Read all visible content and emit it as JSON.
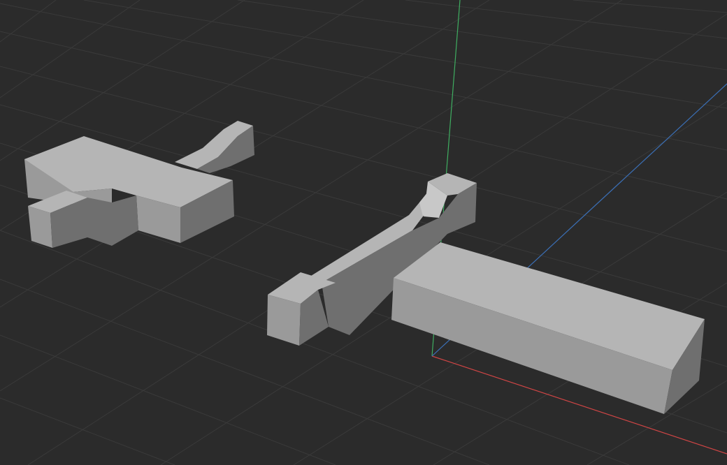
{
  "viewport": {
    "background_color": "#2b2b2b",
    "grid_color": "#3a3a3a",
    "axis_colors": {
      "x": "#d04545",
      "y": "#3fae61",
      "z": "#3b6fb5"
    }
  },
  "objects": [
    {
      "name": "cross-shaped-block",
      "face_colors": [
        "#b5b5b5",
        "#9a9a9a",
        "#6f6f6f"
      ]
    },
    {
      "name": "ramp-bar-block",
      "face_colors": [
        "#b5b5b5",
        "#9a9a9a",
        "#6f6f6f"
      ]
    },
    {
      "name": "long-rectangular-box",
      "face_colors": [
        "#b5b5b5",
        "#9a9a9a",
        "#6f6f6f"
      ]
    }
  ]
}
